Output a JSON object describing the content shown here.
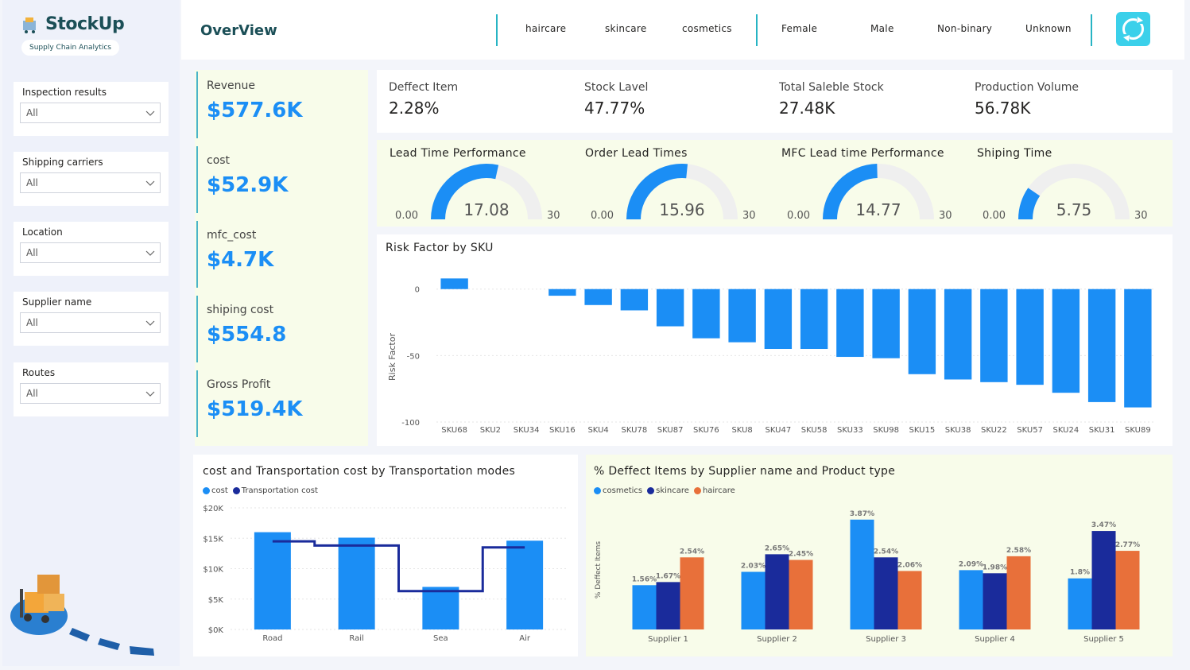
{
  "app": {
    "name": "StockUp",
    "tagline": "Supply Chain Analytics",
    "page_title": "OverView"
  },
  "header": {
    "product_filters": [
      "haircare",
      "skincare",
      "cosmetics"
    ],
    "gender_filters": [
      "Female",
      "Male",
      "Non-binary",
      "Unknown"
    ],
    "refresh_icon": "refresh-icon"
  },
  "slicers": [
    {
      "label": "Inspection results",
      "value": "All"
    },
    {
      "label": "Shipping carriers",
      "value": "All"
    },
    {
      "label": "Location",
      "value": "All"
    },
    {
      "label": "Supplier name",
      "value": "All"
    },
    {
      "label": "Routes",
      "value": "All"
    }
  ],
  "kpis_left": [
    {
      "label": "Revenue",
      "value": "$577.6K"
    },
    {
      "label": "cost",
      "value": "$52.9K"
    },
    {
      "label": "mfc_cost",
      "value": "$4.7K"
    },
    {
      "label": "shiping cost",
      "value": "$554.8"
    },
    {
      "label": "Gross Profit",
      "value": "$519.4K"
    }
  ],
  "kpis_top": [
    {
      "label": "Deffect Item",
      "value": "2.28%"
    },
    {
      "label": "Stock Lavel",
      "value": "47.77%"
    },
    {
      "label": "Total Saleble Stock",
      "value": "27.48K"
    },
    {
      "label": "Production Volume",
      "value": "56.78K"
    }
  ],
  "gauges": [
    {
      "title": "Lead Time Performance",
      "value": 17.08,
      "value_label": "17.08",
      "min_label": "0.00",
      "max_label": "30",
      "min": 0,
      "max": 30
    },
    {
      "title": "Order Lead Times",
      "value": 15.96,
      "value_label": "15.96",
      "min_label": "0.00",
      "max_label": "30",
      "min": 0,
      "max": 30
    },
    {
      "title": "MFC Lead time Performance",
      "value": 14.77,
      "value_label": "14.77",
      "min_label": "0.00",
      "max_label": "30",
      "min": 0,
      "max": 30
    },
    {
      "title": "Shiping Time",
      "value": 5.75,
      "value_label": "5.75",
      "min_label": "0.00",
      "max_label": "30",
      "min": 0,
      "max": 30
    }
  ],
  "colors": {
    "accent": "#1b8ef5",
    "navy": "#1a2b9b",
    "orange": "#e8703a",
    "teal": "#27b4c4",
    "gauge_track": "#efefef"
  },
  "chart_data": [
    {
      "type": "bar",
      "title": "Risk Factor by SKU",
      "ylabel": "Risk Factor",
      "xlabel": "",
      "categories": [
        "SKU68",
        "SKU2",
        "SKU34",
        "SKU16",
        "SKU4",
        "SKU78",
        "SKU87",
        "SKU76",
        "SKU8",
        "SKU47",
        "SKU58",
        "SKU33",
        "SKU98",
        "SKU15",
        "SKU38",
        "SKU22",
        "SKU57",
        "SKU24",
        "SKU31",
        "SKU89"
      ],
      "values": [
        8,
        0,
        0,
        -5,
        -12,
        -16,
        -28,
        -37,
        -40,
        -45,
        -45,
        -51,
        -52,
        -64,
        -68,
        -70,
        -72,
        -78,
        -85,
        -89
      ],
      "ylim": [
        -100,
        10
      ],
      "yticks": [
        0,
        -50,
        -100
      ],
      "ytick_labels": [
        "0",
        "-50",
        "-100"
      ]
    },
    {
      "type": "bar",
      "title": "cost and Transportation cost by Transportation modes",
      "categories": [
        "Road",
        "Rail",
        "Sea",
        "Air"
      ],
      "series": [
        {
          "name": "cost",
          "kind": "bar",
          "values": [
            16000,
            15100,
            7000,
            14600
          ]
        },
        {
          "name": "Transportation cost",
          "kind": "step-line",
          "values": [
            14500,
            13800,
            6300,
            13500
          ]
        }
      ],
      "ylim": [
        0,
        20000
      ],
      "yticks": [
        0,
        5000,
        10000,
        15000,
        20000
      ],
      "ytick_labels": [
        "$0K",
        "$5K",
        "$10K",
        "$15K",
        "$20K"
      ]
    },
    {
      "type": "bar",
      "title": "% Deffect Items by Supplier name and Product type",
      "ylabel": "% Deffect Items",
      "categories": [
        "Supplier 1",
        "Supplier 2",
        "Supplier 3",
        "Supplier 4",
        "Supplier 5"
      ],
      "series": [
        {
          "name": "cosmetics",
          "values": [
            1.56,
            2.03,
            3.87,
            2.09,
            1.8
          ],
          "labels": [
            "1.56%",
            "2.03%",
            "3.87%",
            "2.09%",
            "1.8%"
          ]
        },
        {
          "name": "skincare",
          "values": [
            1.67,
            2.65,
            2.54,
            1.98,
            3.47
          ],
          "labels": [
            "1.67%",
            "2.65%",
            "2.54%",
            "1.98%",
            "3.47%"
          ]
        },
        {
          "name": "haircare",
          "values": [
            2.54,
            2.45,
            2.06,
            2.58,
            2.77
          ],
          "labels": [
            "2.54%",
            "2.45%",
            "2.06%",
            "2.58%",
            "2.77%"
          ]
        }
      ],
      "ylim": [
        0,
        4.2
      ]
    }
  ]
}
